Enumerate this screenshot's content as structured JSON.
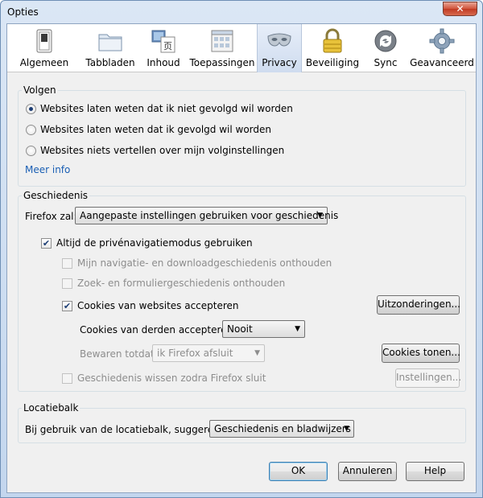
{
  "window": {
    "title": "Opties",
    "close_label": "✕"
  },
  "toolbar": {
    "panes": [
      {
        "label": "Algemeen",
        "icon": "switch-icon"
      },
      {
        "label": "Tabbladen",
        "icon": "folder-tabs-icon"
      },
      {
        "label": "Inhoud",
        "icon": "content-icon"
      },
      {
        "label": "Toepassingen",
        "icon": "applications-icon"
      },
      {
        "label": "Privacy",
        "icon": "mask-icon",
        "selected": true
      },
      {
        "label": "Beveiliging",
        "icon": "lock-icon"
      },
      {
        "label": "Sync",
        "icon": "sync-icon"
      },
      {
        "label": "Geavanceerd",
        "icon": "gear-icon"
      }
    ]
  },
  "tracking": {
    "legend": "Volgen",
    "options": [
      {
        "label": "Websites laten weten dat ik niet gevolgd wil worden",
        "checked": true
      },
      {
        "label": "Websites laten weten dat ik gevolgd wil worden",
        "checked": false
      },
      {
        "label": "Websites niets vertellen over mijn volginstellingen",
        "checked": false
      }
    ],
    "more_info": "Meer info"
  },
  "history": {
    "legend": "Geschiedenis",
    "firefox_will_label": "Firefox zal:",
    "firefox_will_value": "Aangepaste instellingen gebruiken voor geschiedenis",
    "private_mode": {
      "label": "Altijd de privénavigatiemodus gebruiken",
      "checked": true
    },
    "browsing_history": {
      "label": "Mijn navigatie- en downloadgeschiedenis onthouden",
      "checked": false,
      "disabled": true
    },
    "form_history": {
      "label": "Zoek- en formuliergeschiedenis onthouden",
      "checked": false,
      "disabled": true
    },
    "accept_cookies": {
      "label": "Cookies van websites accepteren",
      "checked": true
    },
    "exceptions_button": "Uitzonderingen...",
    "third_party_label": "Cookies van derden accepteren:",
    "third_party_value": "Nooit",
    "keep_until_label": "Bewaren totdat:",
    "keep_until_value": "ik Firefox afsluit",
    "show_cookies_button": "Cookies tonen...",
    "clear_on_close": {
      "label": "Geschiedenis wissen zodra Firefox sluit",
      "checked": false,
      "disabled": true
    },
    "settings_button": "Instellingen..."
  },
  "location_bar": {
    "legend": "Locatiebalk",
    "suggest_label": "Bij gebruik van de locatiebalk, suggereren:",
    "suggest_value": "Geschiedenis en bladwijzers"
  },
  "dialog_buttons": {
    "ok": "OK",
    "cancel": "Annuleren",
    "help": "Help"
  }
}
